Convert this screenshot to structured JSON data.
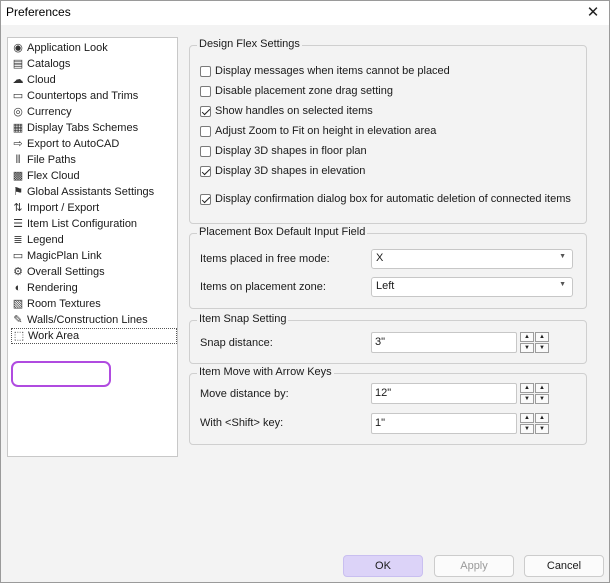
{
  "window": {
    "title": "Preferences",
    "close_glyph": "✕"
  },
  "tree": {
    "items": [
      {
        "label": "Application Look",
        "icon": "eye-icon",
        "glyph": "◉"
      },
      {
        "label": "Catalogs",
        "icon": "catalog-icon",
        "glyph": "▤"
      },
      {
        "label": "Cloud",
        "icon": "cloud-icon",
        "glyph": "☁"
      },
      {
        "label": "Countertops and Trims",
        "icon": "countertop-icon",
        "glyph": "▭"
      },
      {
        "label": "Currency",
        "icon": "currency-icon",
        "glyph": "◎"
      },
      {
        "label": "Display Tabs Schemes",
        "icon": "tabs-icon",
        "glyph": "▦"
      },
      {
        "label": "Export to AutoCAD",
        "icon": "export-icon",
        "glyph": "⇨"
      },
      {
        "label": "File Paths",
        "icon": "file-paths-icon",
        "glyph": "⦀"
      },
      {
        "label": "Flex Cloud",
        "icon": "flex-cloud-icon",
        "glyph": "▩"
      },
      {
        "label": "Global Assistants Settings",
        "icon": "flag-icon",
        "glyph": "⚑"
      },
      {
        "label": "Import / Export",
        "icon": "import-export-icon",
        "glyph": "⇅"
      },
      {
        "label": "Item List Configuration",
        "icon": "list-config-icon",
        "glyph": "☰"
      },
      {
        "label": "Legend",
        "icon": "legend-icon",
        "glyph": "≣"
      },
      {
        "label": "MagicPlan Link",
        "icon": "link-icon",
        "glyph": "▭"
      },
      {
        "label": "Overall Settings",
        "icon": "gear-icon",
        "glyph": "⚙"
      },
      {
        "label": "Rendering",
        "icon": "rendering-icon",
        "glyph": "◐"
      },
      {
        "label": "Room Textures",
        "icon": "textures-icon",
        "glyph": "▧"
      },
      {
        "label": "Walls/Construction Lines",
        "icon": "pencil-icon",
        "glyph": "✎"
      },
      {
        "label": "Work Area",
        "icon": "work-area-icon",
        "glyph": "⬚"
      }
    ],
    "selected": "Work Area"
  },
  "design_flex": {
    "title": "Design Flex Settings",
    "options": [
      {
        "label": "Display messages when items cannot be placed",
        "checked": false
      },
      {
        "label": "Disable placement zone drag setting",
        "checked": false
      },
      {
        "label": "Show handles on selected items",
        "checked": true
      },
      {
        "label": "Adjust Zoom to Fit on height in elevation area",
        "checked": false
      },
      {
        "label": "Display 3D shapes in floor plan",
        "checked": false
      },
      {
        "label": "Display 3D shapes in elevation",
        "checked": true
      },
      {
        "label": "Display confirmation dialog box for automatic deletion of connected items",
        "checked": true
      }
    ]
  },
  "placement_box": {
    "title": "Placement Box Default Input Field",
    "free_mode_label": "Items placed in free mode:",
    "free_mode_value": "X",
    "zone_label": "Items on placement zone:",
    "zone_value": "Left"
  },
  "item_snap": {
    "title": "Item Snap Setting",
    "snap_label": "Snap distance:",
    "snap_value": "3\""
  },
  "arrow_keys": {
    "title": "Item Move with Arrow Keys",
    "move_label": "Move distance by:",
    "move_value": "12\"",
    "shift_label": "With <Shift> key:",
    "shift_value": "1\""
  },
  "spinner": {
    "up": "▲",
    "down": "▼"
  },
  "buttons": {
    "ok": "OK",
    "apply": "Apply",
    "cancel": "Cancel"
  },
  "colors": {
    "accent": "#dcd3f8",
    "highlight_ring": "#b04be0"
  }
}
